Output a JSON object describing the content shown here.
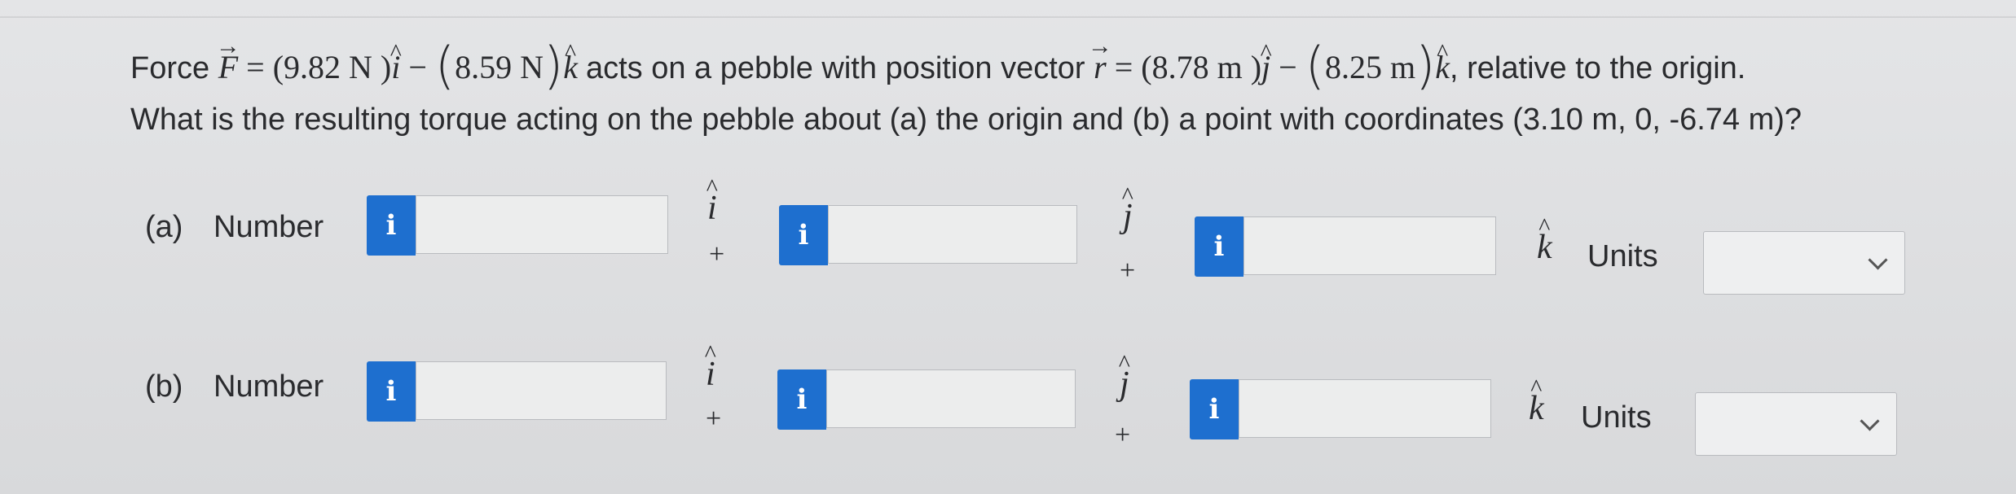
{
  "question": {
    "force_word": "Force",
    "F_symbol": "F",
    "eq": "=",
    "F_x": "(9.82 N )",
    "i_hat": "i",
    "minus": "−",
    "F_z": "8.59 N",
    "k_hat": "k",
    "acts_text": "acts on a pebble with position vector",
    "r_symbol": "r",
    "r_y": "(8.78 m )",
    "j_hat": "j",
    "r_z": "8.25 m",
    "relative_text": ", relative to the origin.",
    "line2": "What is the resulting torque acting on the pebble about (a) the origin and (b) a point with coordinates (3.10 m, 0, -6.74 m)?"
  },
  "parts": [
    {
      "label": "(a)",
      "number_label": "Number",
      "info": "i",
      "i_value": "",
      "j_value": "",
      "k_value": "",
      "i_unit": "i",
      "j_unit": "j",
      "k_unit": "k",
      "plus": "+",
      "units_label": "Units",
      "units_value": ""
    },
    {
      "label": "(b)",
      "number_label": "Number",
      "info": "i",
      "i_value": "",
      "j_value": "",
      "k_value": "",
      "i_unit": "i",
      "j_unit": "j",
      "k_unit": "k",
      "plus": "+",
      "units_label": "Units",
      "units_value": ""
    }
  ],
  "colors": {
    "info_button": "#1e6fcf",
    "background": "#e0e1e3"
  },
  "icons": {
    "info": "info-icon",
    "dropdown": "chevron-down-icon"
  }
}
